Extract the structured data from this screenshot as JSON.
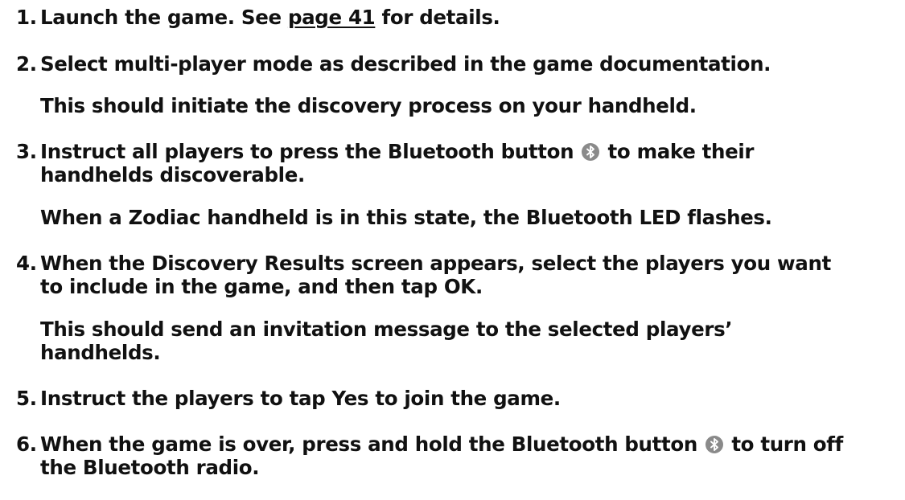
{
  "steps": [
    {
      "number": "1.",
      "text_before": "Launch the game. See ",
      "link": "page 41",
      "text_after": " for details."
    },
    {
      "number": "2.",
      "text": "Select multi-player mode as described in the game documentation.",
      "note": "This should initiate the discovery process on your handheld."
    },
    {
      "number": "3.",
      "text_before": "Instruct all players to press the Bluetooth button",
      "text_after": "to make their",
      "text_line2": "handhelds discoverable.",
      "note": "When a Zodiac handheld is in this state, the Bluetooth LED flashes."
    },
    {
      "number": "4.",
      "text_line1": "When the Discovery Results screen appears, select the players you want",
      "text_line2": "to include in the game, and then tap OK.",
      "note_line1": "This should send an invitation message to the selected players’",
      "note_line2": "handhelds."
    },
    {
      "number": "5.",
      "text": "Instruct the players to tap Yes to join the game."
    },
    {
      "number": "6.",
      "text_before": "When the game is over, press and hold the Bluetooth button",
      "text_after": "to turn off",
      "text_line2": "the Bluetooth radio."
    }
  ],
  "icons": {
    "bluetooth": "bluetooth-icon"
  },
  "colors": {
    "text": "#111111",
    "icon_background": "#8a8a8a",
    "icon_symbol": "#ffffff"
  }
}
